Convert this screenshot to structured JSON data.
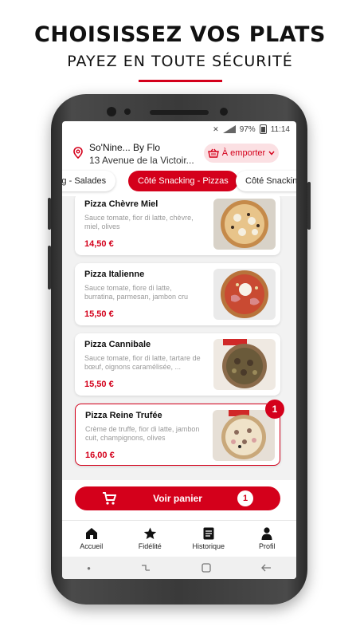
{
  "promo": {
    "headline": "CHOISISSEZ VOS PLATS",
    "subline": "PAYEZ EN TOUTE SÉCURITÉ"
  },
  "status_bar": {
    "battery": "97%",
    "time": "11:14"
  },
  "header": {
    "store_name": "So'Nine... By Flo",
    "address": "13 Avenue de la Victoir...",
    "mode_label": "À emporter"
  },
  "tabs": [
    {
      "label": "Côté Snacking - Salades",
      "active": false
    },
    {
      "label": "Côté Snacking - Pizzas",
      "active": true
    },
    {
      "label": "Côté Snacking",
      "active": false
    }
  ],
  "products": [
    {
      "name": "Pizza Chèvre Miel",
      "description": "Sauce tomate, fior di latte, chèvre, miel, olives",
      "price": "14,50 €",
      "quantity": null
    },
    {
      "name": "Pizza Italienne",
      "description": "Sauce tomate, fiore di latte, burratina, parmesan, jambon cru",
      "price": "15,50 €",
      "quantity": null
    },
    {
      "name": "Pizza Cannibale",
      "description": "Sauce tomate, fior di latte, tartare de bœuf, oignons caramélisée, ...",
      "price": "15,50 €",
      "quantity": null
    },
    {
      "name": "Pizza Reine Trufée",
      "description": "Crème de truffe, fior di latte, jambon cuit, champignons, olives",
      "price": "16,00 €",
      "quantity": "1"
    }
  ],
  "cart": {
    "label": "Voir panier",
    "count": "1"
  },
  "bottom_nav": [
    {
      "label": "Accueil",
      "icon": "home-icon"
    },
    {
      "label": "Fidélité",
      "icon": "star-icon"
    },
    {
      "label": "Historique",
      "icon": "history-icon"
    },
    {
      "label": "Profil",
      "icon": "profile-icon"
    }
  ],
  "colors": {
    "accent": "#d4001b",
    "accent_light": "#fbe0e3"
  }
}
